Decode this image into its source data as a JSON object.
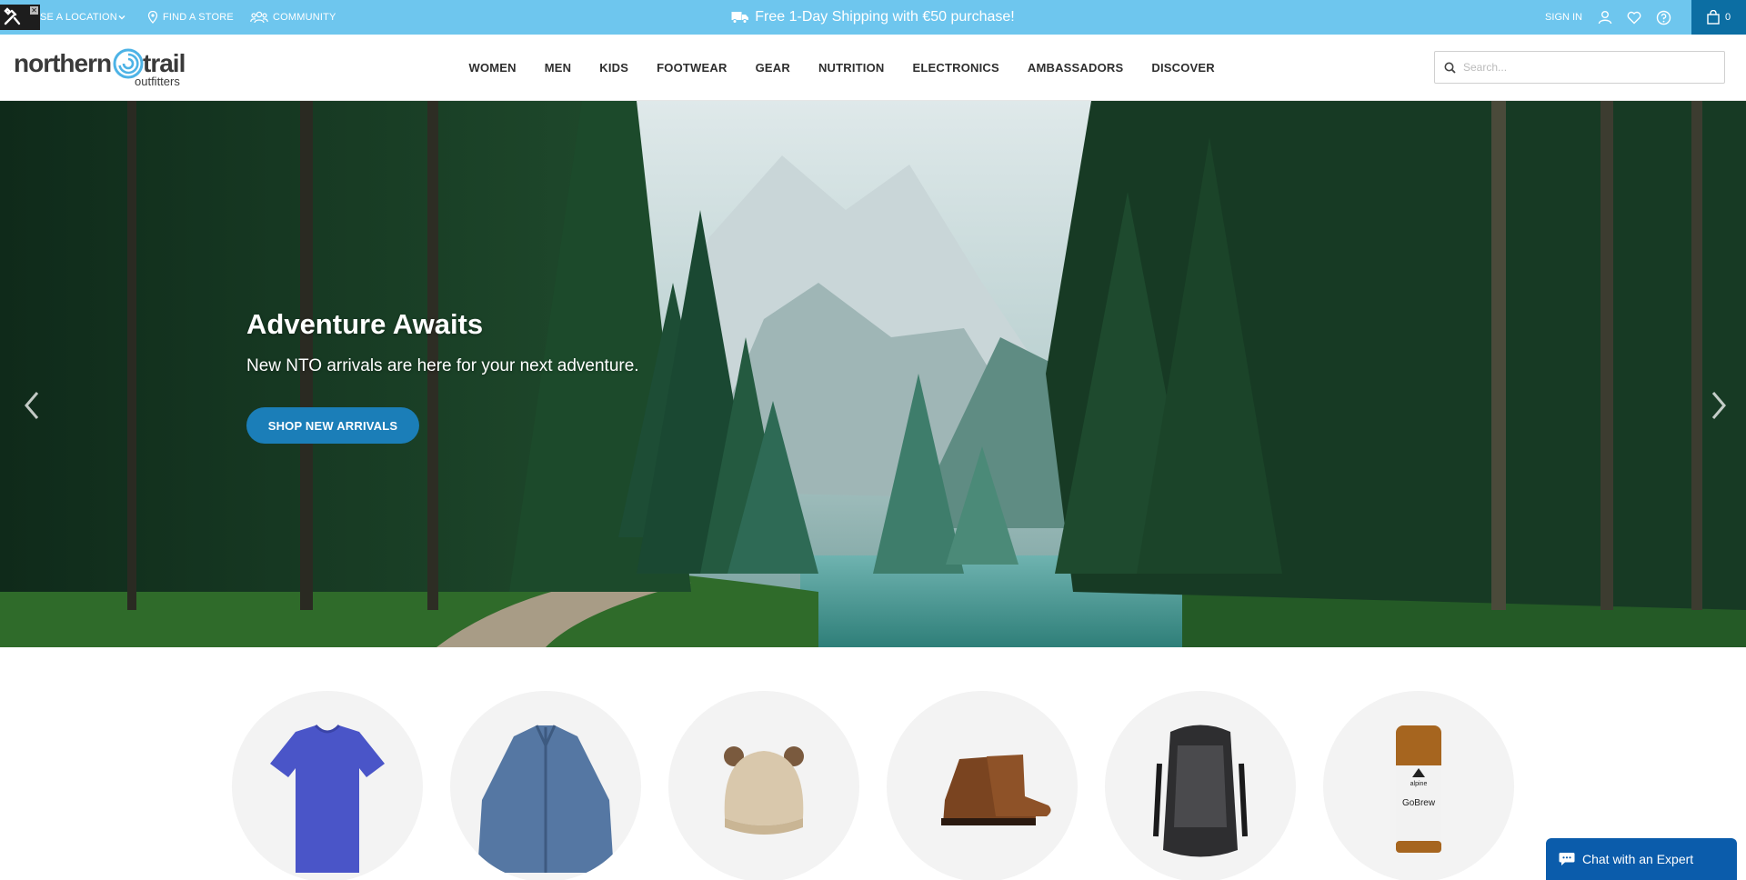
{
  "topbar": {
    "location_label": "SE A LOCATION",
    "find_store_label": "FIND A STORE",
    "community_label": "COMMUNITY",
    "promo_text": "Free 1-Day Shipping with €50 purchase!",
    "signin_label": "SIGN IN",
    "cart_count": "0"
  },
  "logo": {
    "word1": "northern",
    "word2": "trail",
    "sub": "outfitters"
  },
  "nav": {
    "items": [
      "WOMEN",
      "MEN",
      "KIDS",
      "FOOTWEAR",
      "GEAR",
      "NUTRITION",
      "ELECTRONICS",
      "AMBASSADORS",
      "DISCOVER"
    ]
  },
  "search": {
    "placeholder": "Search..."
  },
  "hero": {
    "title": "Adventure Awaits",
    "subtitle": "New NTO arrivals are here for your next adventure.",
    "button_label": "SHOP NEW ARRIVALS"
  },
  "categories": {
    "items": [
      "t-shirt",
      "jacket",
      "beanie",
      "boots",
      "backpack",
      "beverage-can"
    ],
    "can_brand": "alpine",
    "can_product": "GoBrew"
  },
  "chat": {
    "label": "Chat with an Expert"
  },
  "colors": {
    "topbar": "#6ec6ee",
    "cart": "#0c6ea3",
    "hero_button": "#1b7eb8",
    "chat": "#0b5cab"
  }
}
